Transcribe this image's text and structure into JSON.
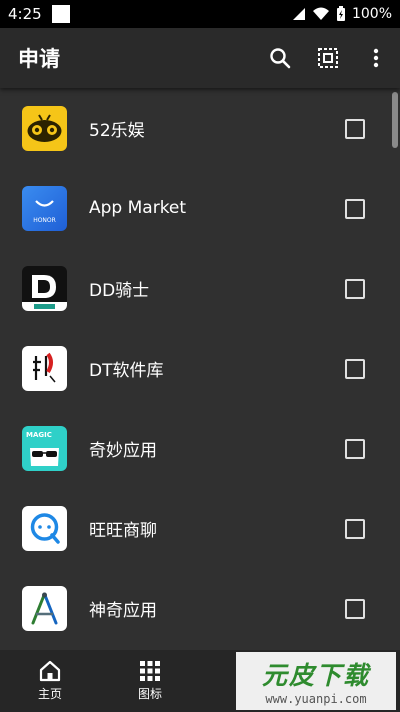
{
  "status_bar": {
    "time": "4:25",
    "battery": "100%"
  },
  "app_bar": {
    "title": "申请",
    "actions": [
      "search-icon",
      "select-all-icon",
      "more-vert-icon"
    ]
  },
  "apps": [
    {
      "name": "52乐娱",
      "icon": "gamepad-bee-icon",
      "checked": false
    },
    {
      "name": "App Market",
      "icon": "honor-bag-icon",
      "checked": false
    },
    {
      "name": "DD骑士",
      "icon": "dd-logo-icon",
      "checked": false
    },
    {
      "name": "DT软件库",
      "icon": "dt-calligraphy-icon",
      "checked": false
    },
    {
      "name": "奇妙应用",
      "icon": "magic-sunglasses-icon",
      "checked": false
    },
    {
      "name": "旺旺商聊",
      "icon": "chat-bubble-icon",
      "checked": false
    },
    {
      "name": "神奇应用",
      "icon": "compass-a-icon",
      "checked": false
    }
  ],
  "bottom_nav": [
    {
      "label": "主页",
      "icon": "home-icon"
    },
    {
      "label": "图标",
      "icon": "grid-icon"
    }
  ],
  "watermark": {
    "title": "元皮下载",
    "url": "www.yuanpi.com"
  }
}
